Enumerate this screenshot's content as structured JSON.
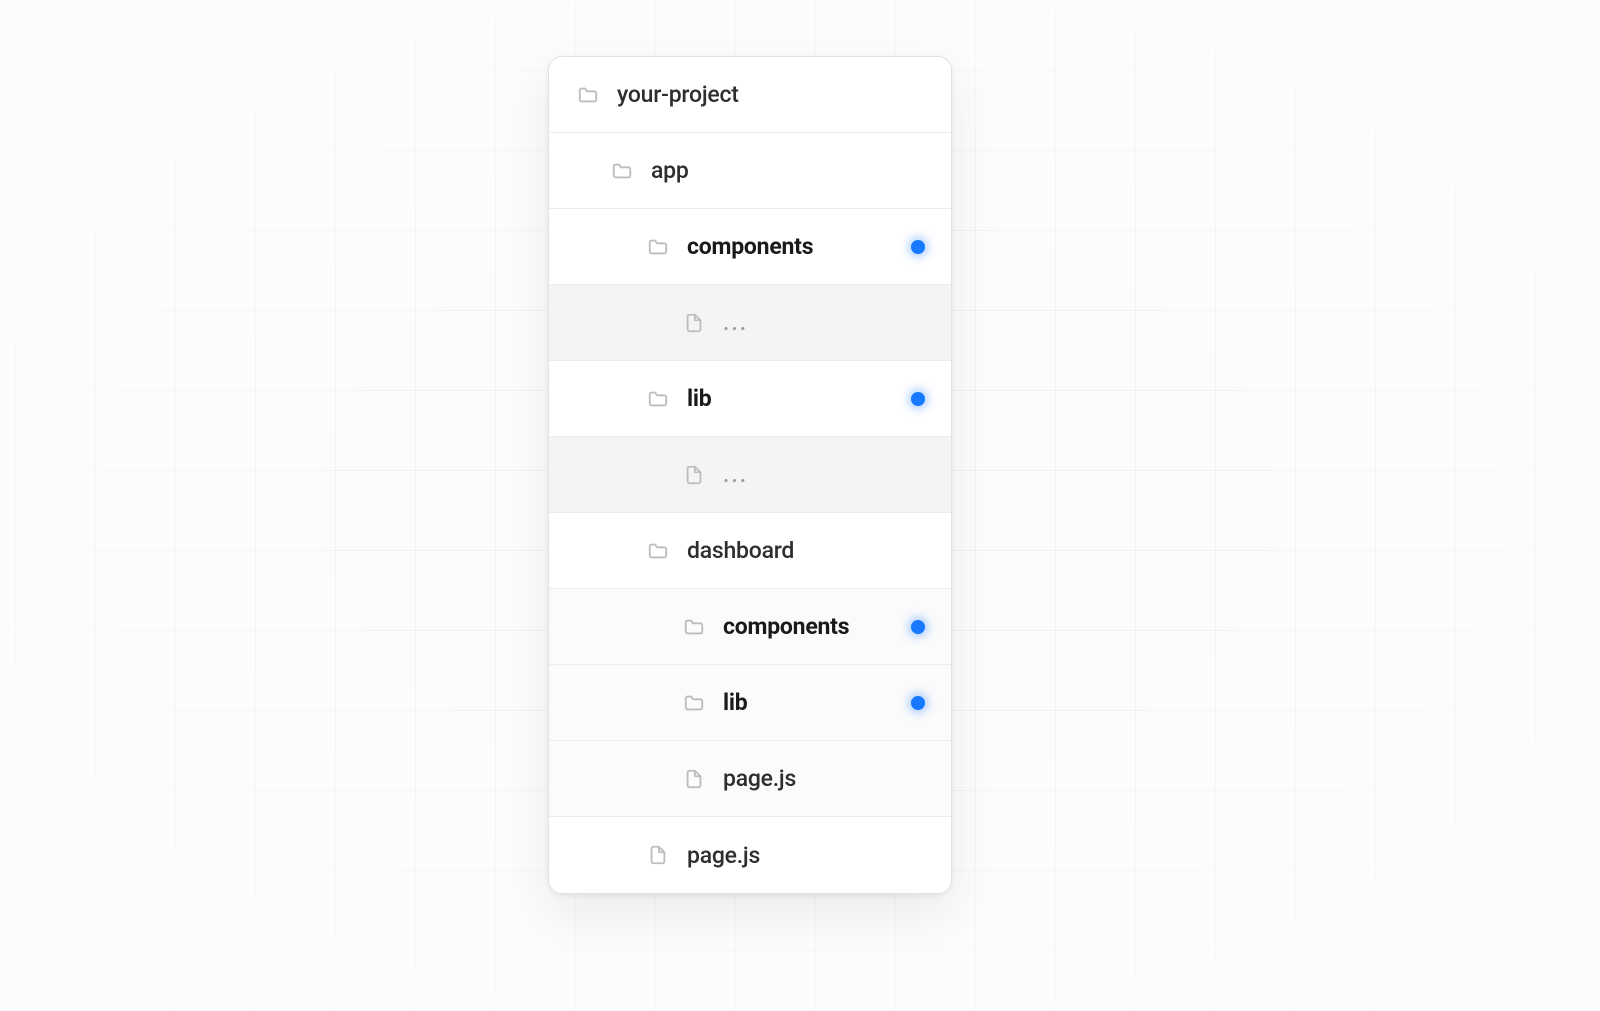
{
  "tree": {
    "root": {
      "name": "your-project",
      "icon": "folder"
    },
    "items": [
      {
        "indent": 1,
        "icon": "folder",
        "label": "app",
        "bold": false,
        "dot": false,
        "muted": false
      },
      {
        "indent": 2,
        "icon": "folder",
        "label": "components",
        "bold": true,
        "dot": true,
        "muted": false
      },
      {
        "indent": 3,
        "icon": "file",
        "label": "...",
        "bold": false,
        "dot": false,
        "muted": true
      },
      {
        "indent": 2,
        "icon": "folder",
        "label": "lib",
        "bold": true,
        "dot": true,
        "muted": false
      },
      {
        "indent": 3,
        "icon": "file",
        "label": "...",
        "bold": false,
        "dot": false,
        "muted": true
      },
      {
        "indent": 2,
        "icon": "folder",
        "label": "dashboard",
        "bold": false,
        "dot": false,
        "muted": false
      },
      {
        "indent": 3,
        "icon": "folder",
        "label": "components",
        "bold": true,
        "dot": true,
        "muted": false,
        "sub": true
      },
      {
        "indent": 3,
        "icon": "folder",
        "label": "lib",
        "bold": true,
        "dot": true,
        "muted": false,
        "sub": true
      },
      {
        "indent": 3,
        "icon": "file",
        "label": "page.js",
        "bold": false,
        "dot": false,
        "muted": false,
        "sub": true
      },
      {
        "indent": 2,
        "icon": "file",
        "label": "page.js",
        "bold": false,
        "dot": false,
        "muted": false
      }
    ]
  },
  "colors": {
    "dot": "#1679ff"
  }
}
